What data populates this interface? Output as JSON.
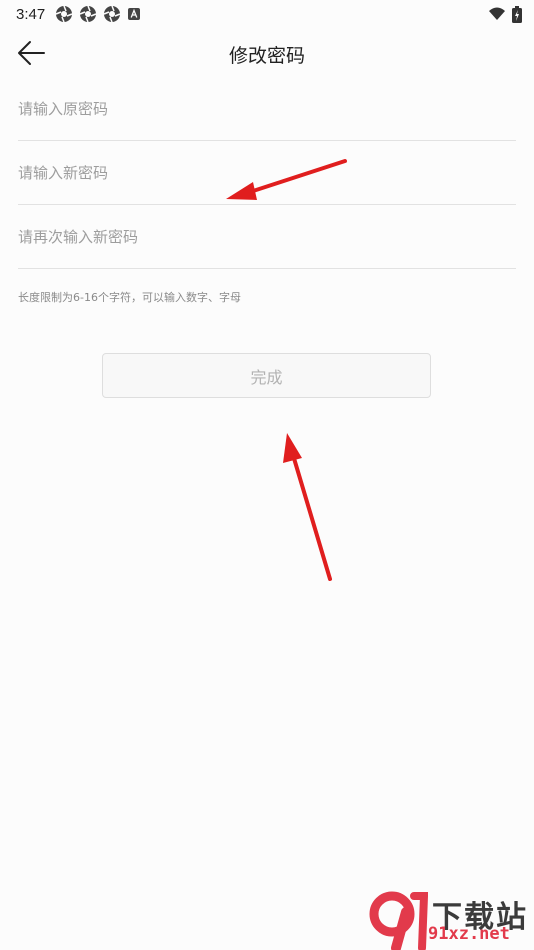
{
  "status_bar": {
    "time": "3:47",
    "left_icons": [
      "aperture-icon",
      "aperture-icon",
      "aperture-icon",
      "keyboard-a-icon"
    ],
    "right_icons": [
      "wifi-icon",
      "battery-charging-icon"
    ]
  },
  "header": {
    "title": "修改密码",
    "back_icon": "arrow-left-icon"
  },
  "form": {
    "old_password_placeholder": "请输入原密码",
    "new_password_placeholder": "请输入新密码",
    "confirm_password_placeholder": "请再次输入新密码",
    "hint": "长度限制为6-16个字符，可以输入数字、字母",
    "submit_label": "完成"
  },
  "annotations": {
    "arrow_color": "#e01e1e"
  },
  "watermark": {
    "logo_text": "9",
    "name": "下载站",
    "site": "91xz.net",
    "accent_color": "#e23a4b"
  }
}
